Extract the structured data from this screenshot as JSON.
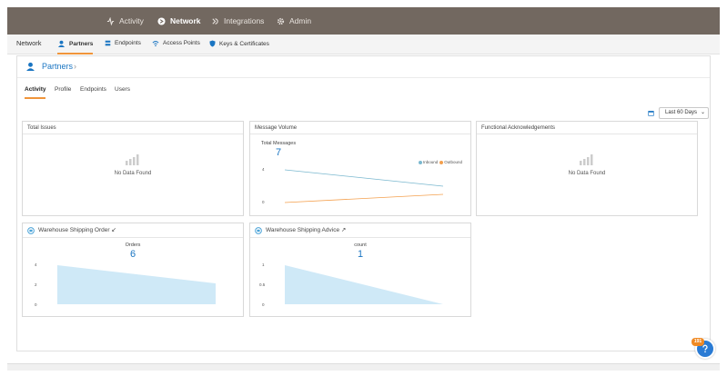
{
  "topnav": {
    "items": [
      {
        "label": "Activity",
        "icon": "activity-icon"
      },
      {
        "label": "Network",
        "icon": "network-icon",
        "active": true
      },
      {
        "label": "Integrations",
        "icon": "integrations-icon"
      },
      {
        "label": "Admin",
        "icon": "gear-icon"
      }
    ]
  },
  "subnav": {
    "root": "Network",
    "items": [
      {
        "label": "Partners",
        "icon": "partners-icon",
        "active": true
      },
      {
        "label": "Endpoints",
        "icon": "endpoints-icon"
      },
      {
        "label": "Access Points",
        "icon": "access-points-icon"
      },
      {
        "label": "Keys & Certificates",
        "icon": "shield-icon"
      }
    ]
  },
  "page": {
    "title": "Partners",
    "tabs": [
      "Activity",
      "Profile",
      "Endpoints",
      "Users"
    ],
    "active_tab": "Activity",
    "date_range": "Last 60 Days"
  },
  "cards": {
    "total_issues": {
      "title": "Total Issues",
      "nodata": "No Data Found"
    },
    "message_volume": {
      "title": "Message Volume",
      "metric_label": "Total Messages",
      "metric_value": "7",
      "legend": [
        {
          "name": "Inbound",
          "color": "#7ab8cf"
        },
        {
          "name": "Outbound",
          "color": "#f4a04e"
        }
      ],
      "ticks": [
        "4",
        "0"
      ]
    },
    "functional_ack": {
      "title": "Functional Acknowledgements",
      "nodata": "No Data Found"
    },
    "shipping_order": {
      "title": "Warehouse Shipping Order",
      "arrow": "↙",
      "metric_label": "Orders",
      "metric_value": "6",
      "ticks": [
        "4",
        "2",
        "0"
      ]
    },
    "shipping_advice": {
      "title": "Warehouse Shipping Advice",
      "arrow": "↗",
      "metric_label": "count",
      "metric_value": "1",
      "ticks": [
        "1",
        "0.5",
        "0"
      ]
    }
  },
  "notifications": {
    "badge": "191"
  },
  "colors": {
    "accent": "#1a75c2",
    "nav_bg": "#726860",
    "tab_underline": "#f0953a",
    "area_fill": "#cfe9f7"
  }
}
